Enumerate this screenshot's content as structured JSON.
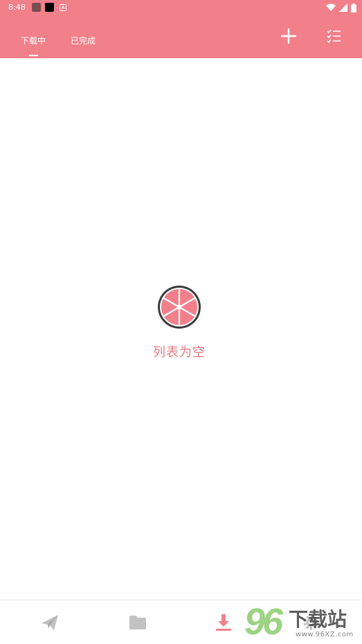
{
  "status_bar": {
    "time": "8:48"
  },
  "tabs": [
    {
      "label": "下载中",
      "active": true
    },
    {
      "label": "已完成",
      "active": false
    }
  ],
  "toolbar": {
    "add_icon": "plus-icon",
    "list_icon": "checklist-icon"
  },
  "empty_state": {
    "icon": "grapefruit-icon",
    "text": "列表为空"
  },
  "bottom_nav": [
    {
      "icon": "send-icon",
      "active": false
    },
    {
      "icon": "folder-icon",
      "active": false
    },
    {
      "icon": "download-icon",
      "active": true
    },
    {
      "icon": "gear-icon",
      "active": false
    }
  ],
  "watermark": {
    "number": "96",
    "title": "下载站",
    "url": "www.96XZ.com"
  },
  "colors": {
    "primary": "#f2808a",
    "accent": "#e47a83",
    "nav_inactive": "#c2c2c2"
  }
}
